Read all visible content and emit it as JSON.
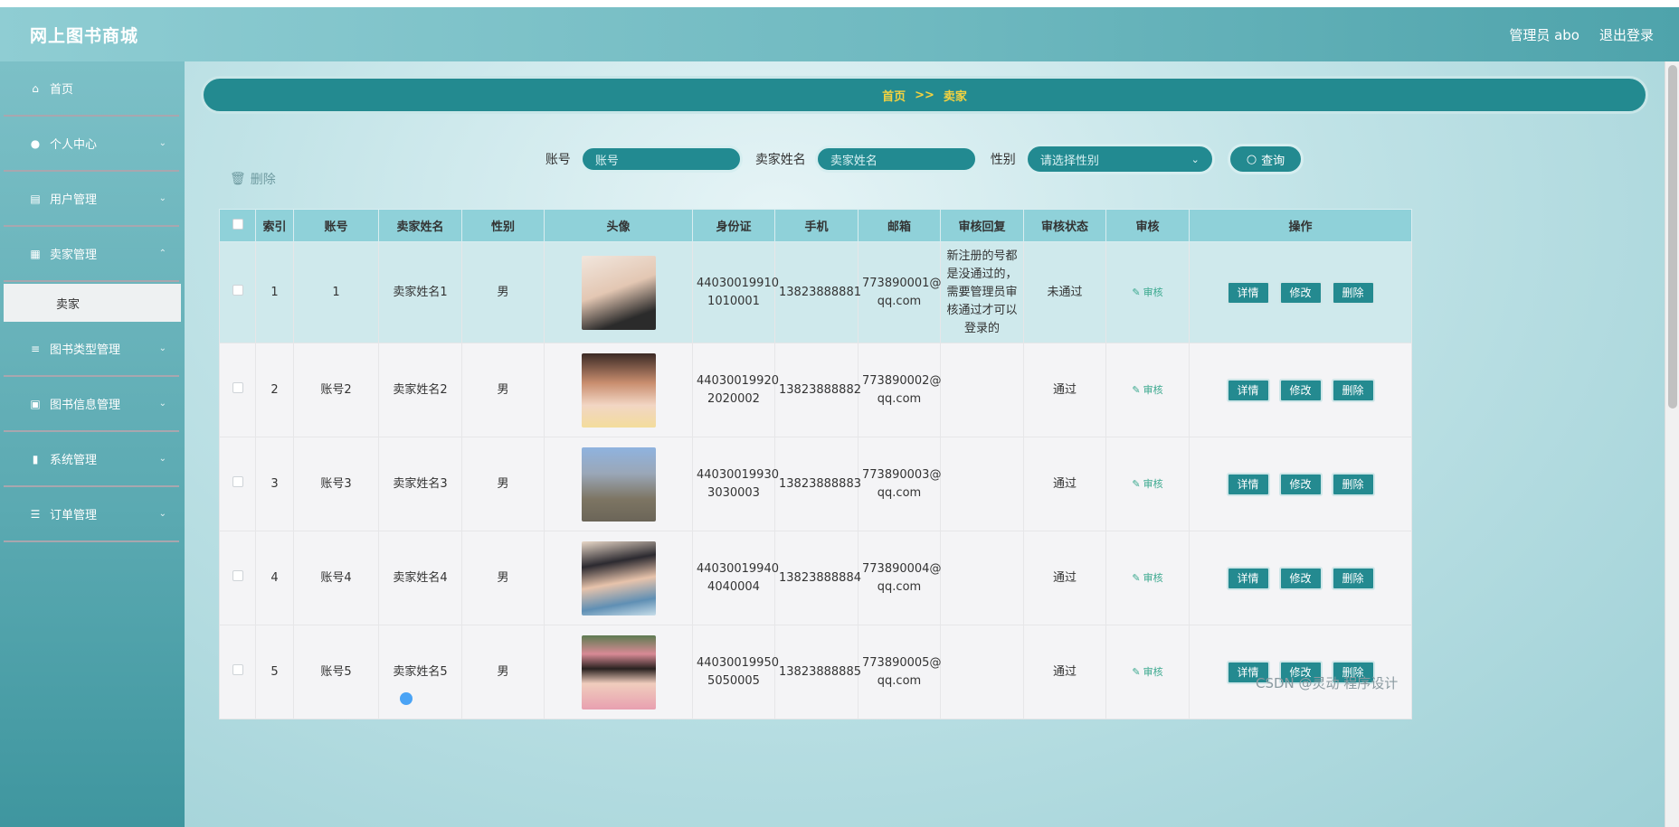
{
  "header": {
    "brand": "网上图书商城",
    "user_label": "管理员 abo",
    "logout_label": "退出登录"
  },
  "sidebar": {
    "items": [
      {
        "label": "首页",
        "icon": "home-icon"
      },
      {
        "label": "个人中心",
        "icon": "user-icon"
      },
      {
        "label": "用户管理",
        "icon": "user-manage-icon"
      },
      {
        "label": "卖家管理",
        "icon": "grid-icon"
      },
      {
        "label": "图书类型管理",
        "icon": "sliders-icon"
      },
      {
        "label": "图书信息管理",
        "icon": "briefcase-icon"
      },
      {
        "label": "系统管理",
        "icon": "bar-chart-icon"
      },
      {
        "label": "订单管理",
        "icon": "list-icon"
      }
    ],
    "submenu_active": "卖家"
  },
  "breadcrumb": {
    "home": "首页",
    "separator": ">>",
    "current": "卖家"
  },
  "search": {
    "account_label": "账号",
    "account_placeholder": "账号",
    "name_label": "卖家姓名",
    "name_placeholder": "卖家姓名",
    "gender_label": "性别",
    "gender_placeholder": "请选择性别",
    "query_button": "查询"
  },
  "toolbar": {
    "delete_label": "删除"
  },
  "table": {
    "headers": [
      "索引",
      "账号",
      "卖家姓名",
      "性别",
      "头像",
      "身份证",
      "手机",
      "邮箱",
      "审核回复",
      "审核状态",
      "审核",
      "操作"
    ],
    "rows": [
      {
        "index": "1",
        "account": "1",
        "name": "卖家姓名1",
        "gender": "男",
        "id_line1": "44030019910",
        "id_line2": "1010001",
        "phone": "13823888881",
        "email_line1": "773890001@",
        "email_line2": "qq.com",
        "reply": "新注册的号都是没通过的，需要管理员审核通过才可以登录的",
        "status": "未通过",
        "avatar_color": "#2b2b2b"
      },
      {
        "index": "2",
        "account": "账号2",
        "name": "卖家姓名2",
        "gender": "男",
        "id_line1": "44030019920",
        "id_line2": "2020002",
        "phone": "13823888882",
        "email_line1": "773890002@",
        "email_line2": "qq.com",
        "reply": "",
        "status": "通过",
        "avatar_color": "#c98e6f"
      },
      {
        "index": "3",
        "account": "账号3",
        "name": "卖家姓名3",
        "gender": "男",
        "id_line1": "44030019930",
        "id_line2": "3030003",
        "phone": "13823888883",
        "email_line1": "773890003@",
        "email_line2": "qq.com",
        "reply": "",
        "status": "通过",
        "avatar_color": "#6b7f98"
      },
      {
        "index": "4",
        "account": "账号4",
        "name": "卖家姓名4",
        "gender": "男",
        "id_line1": "44030019940",
        "id_line2": "4040004",
        "phone": "13823888884",
        "email_line1": "773890004@",
        "email_line2": "qq.com",
        "reply": "",
        "status": "通过",
        "avatar_color": "#5f8fb4"
      },
      {
        "index": "5",
        "account": "账号5",
        "name": "卖家姓名5",
        "gender": "男",
        "id_line1": "44030019950",
        "id_line2": "5050005",
        "phone": "13823888885",
        "email_line1": "773890005@",
        "email_line2": "qq.com",
        "reply": "",
        "status": "通过",
        "avatar_color": "#d88a95"
      }
    ],
    "audit_label": "审核",
    "op_detail": "详情",
    "op_edit": "修改",
    "op_delete": "删除"
  },
  "watermark": "CSDN @灵动 程序设计"
}
